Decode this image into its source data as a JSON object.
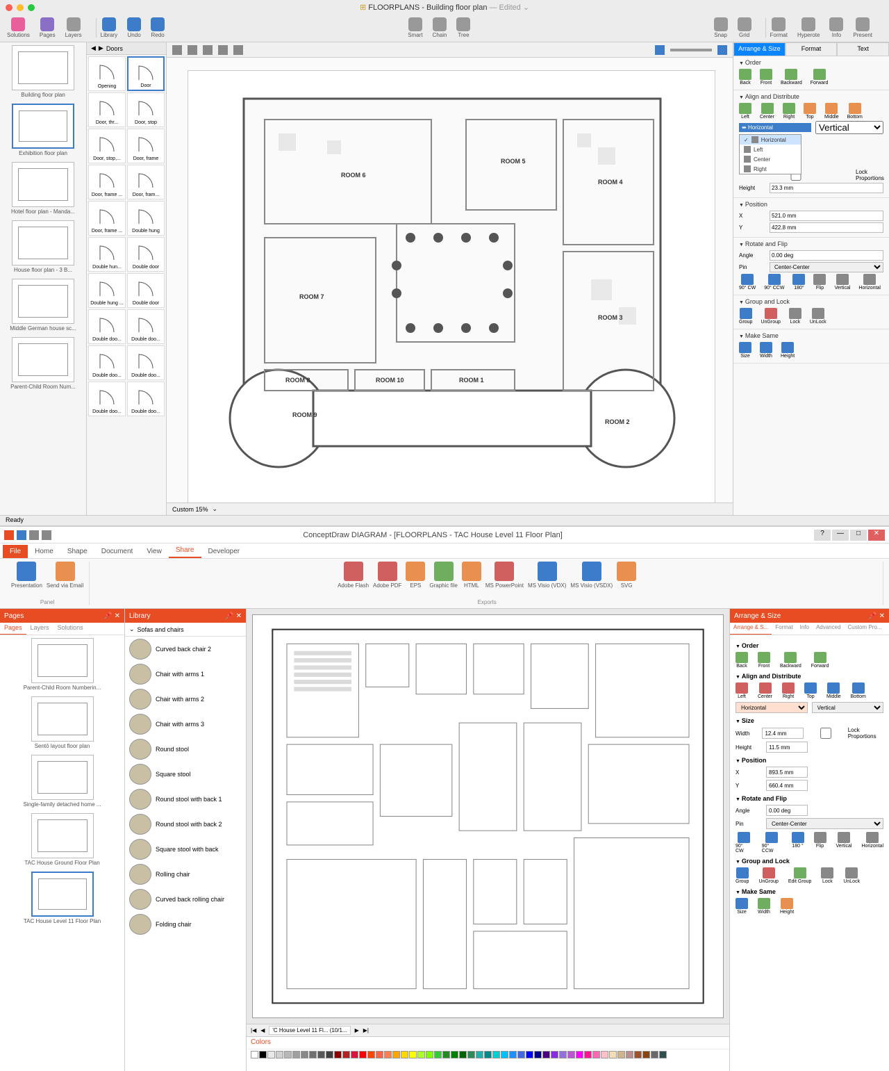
{
  "app1": {
    "title_prefix": "FLOORPLANS",
    "title_doc": "Building floor plan",
    "title_suffix": "— Edited",
    "toolbar_left": [
      "Solutions",
      "Pages",
      "Layers"
    ],
    "toolbar_mid": [
      "Library",
      "Undo",
      "Redo"
    ],
    "toolbar_center": [
      "Smart",
      "Chain",
      "Tree"
    ],
    "toolbar_right": [
      "Snap",
      "Grid"
    ],
    "toolbar_far": [
      "Format",
      "Hyperote",
      "Info",
      "Present"
    ],
    "thumbs": [
      {
        "label": "Building floor plan",
        "sel": false
      },
      {
        "label": "Exhibition floor plan",
        "sel": true
      },
      {
        "label": "Hotel floor plan - Manda...",
        "sel": false
      },
      {
        "label": "House floor plan - 3 B...",
        "sel": false
      },
      {
        "label": "Middle German house sc...",
        "sel": false
      },
      {
        "label": "Parent-Child Room Num...",
        "sel": false
      }
    ],
    "lib_name": "Doors",
    "lib_items": [
      "Opening",
      "Door",
      "Door, thr...",
      "Door, stop",
      "Door, stop,...",
      "Door, frame",
      "Door, frame ...",
      "Door, fram...",
      "Door, frame ...",
      "Double hung",
      "Double hun...",
      "Double door",
      "Double hung ...",
      "Double door",
      "Double doo...",
      "Double doo...",
      "Double doo...",
      "Double doo...",
      "Double doo...",
      "Double doo..."
    ],
    "rooms": [
      "ROOM 1",
      "ROOM 2",
      "ROOM 3",
      "ROOM 4",
      "ROOM 5",
      "ROOM 6",
      "ROOM 7",
      "ROOM 8",
      "ROOM 9",
      "ROOM 10"
    ],
    "zoom_label": "Custom 15%",
    "prop_tabs": [
      "Arrange & Size",
      "Format",
      "Text"
    ],
    "order_h": "Order",
    "order_btns": [
      "Back",
      "Front",
      "Backward",
      "Forward"
    ],
    "align_h": "Align and Distribute",
    "align_btns": [
      "Left",
      "Center",
      "Right",
      "Top",
      "Middle",
      "Bottom"
    ],
    "align_dd_sel": "Horizontal",
    "align_dd_items": [
      "Horizontal",
      "Left",
      "Center",
      "Right"
    ],
    "align_dd2": "Vertical",
    "lock_prop": "Lock Proportions",
    "size_height_lbl": "Height",
    "size_height": "23.3 mm",
    "position_h": "Position",
    "pos_x_lbl": "X",
    "pos_x": "521.0 mm",
    "pos_y_lbl": "Y",
    "pos_y": "422.8 mm",
    "rotate_h": "Rotate and Flip",
    "angle_lbl": "Angle",
    "angle": "0.00 deg",
    "pin_lbl": "Pin",
    "pin": "Center-Center",
    "rotate_btns": [
      "90° CW",
      "90° CCW",
      "180°",
      "Flip",
      "Vertical",
      "Horizontal"
    ],
    "group_h": "Group and Lock",
    "group_btns": [
      "Group",
      "UnGroup",
      "Lock",
      "UnLock"
    ],
    "make_h": "Make Same",
    "make_btns": [
      "Size",
      "Width",
      "Height"
    ],
    "status": "Ready"
  },
  "app2": {
    "title": "ConceptDraw DIAGRAM - [FLOORPLANS - TAC House Level 11 Floor Plan]",
    "ribbon_tabs": [
      "File",
      "Home",
      "Shape",
      "Document",
      "View",
      "Share",
      "Developer"
    ],
    "ribbon_active": "Share",
    "panel_btns": [
      "Presentation",
      "Send via Email"
    ],
    "panel_lbl": "Panel",
    "export_btns": [
      "Adobe Flash",
      "Adobe PDF",
      "EPS",
      "Graphic file",
      "HTML",
      "MS PowerPoint",
      "MS Visio (VDX)",
      "MS Visio (VSDX)",
      "SVG"
    ],
    "export_lbl": "Exports",
    "pages_title": "Pages",
    "pages_tabs": [
      "Pages",
      "Layers",
      "Solutions"
    ],
    "pages": [
      {
        "label": "Parent-Child Room Numberin...",
        "sel": false
      },
      {
        "label": "Sentō layout floor plan",
        "sel": false
      },
      {
        "label": "Single-family detached home ...",
        "sel": false
      },
      {
        "label": "TAC House Ground Floor Plan",
        "sel": false
      },
      {
        "label": "TAC House Level 11 Floor Plan",
        "sel": true
      }
    ],
    "lib_title": "Library",
    "lib_category": "Sofas and chairs",
    "lib_items": [
      "Curved back chair 2",
      "Chair with arms 1",
      "Chair with arms 2",
      "Chair with arms 3",
      "Round stool",
      "Square stool",
      "Round stool with back 1",
      "Round stool with back 2",
      "Square stool with back",
      "Rolling chair",
      "Curved back rolling chair",
      "Folding chair"
    ],
    "sheet_tab": "'C House Level 11 Fl...  (10/1...",
    "colors_title": "Colors",
    "props_title": "Arrange & Size",
    "prop_tabs": [
      "Arrange & S...",
      "Format",
      "Info",
      "Advanced",
      "Custom Pro..."
    ],
    "order_h": "Order",
    "order_btns": [
      "Back",
      "Front",
      "Backward",
      "Forward"
    ],
    "align_h": "Align and Distribute",
    "align_btns": [
      "Left",
      "Center",
      "Right",
      "Top",
      "Middle",
      "Bottom"
    ],
    "align_sel1": "Horizontal",
    "align_sel2": "Vertical",
    "size_h": "Size",
    "width_lbl": "Width",
    "width": "12.4 mm",
    "height_lbl": "Height",
    "height": "11.5 mm",
    "lock_prop": "Lock Proportions",
    "position_h": "Position",
    "pos_x_lbl": "X",
    "pos_x": "893.5 mm",
    "pos_y_lbl": "Y",
    "pos_y": "660.4 mm",
    "rotate_h": "Rotate and Flip",
    "angle_lbl": "Angle",
    "angle": "0.00 deg",
    "pin_lbl": "Pin",
    "pin": "Center-Center",
    "rotate_btns": [
      "90° CW",
      "90° CCW",
      "180 °",
      "Flip",
      "Vertical",
      "Horizontal"
    ],
    "group_h": "Group and Lock",
    "group_btns": [
      "Group",
      "UnGroup",
      "Edit Group",
      "Lock",
      "UnLock"
    ],
    "make_h": "Make Same",
    "make_btns": [
      "Size",
      "Width",
      "Height"
    ],
    "swatch_colors": [
      "#fff",
      "#000",
      "#e8e8e8",
      "#d0d0d0",
      "#b8b8b8",
      "#a0a0a0",
      "#888",
      "#707070",
      "#585858",
      "#404040",
      "#8b0000",
      "#b22222",
      "#dc143c",
      "#ff0000",
      "#ff4500",
      "#ff6347",
      "#ff7f50",
      "#ffa500",
      "#ffd700",
      "#ffff00",
      "#adff2f",
      "#7fff00",
      "#32cd32",
      "#228b22",
      "#008000",
      "#006400",
      "#2e8b57",
      "#20b2aa",
      "#008b8b",
      "#00ced1",
      "#00bfff",
      "#1e90ff",
      "#4169e1",
      "#0000ff",
      "#00008b",
      "#4b0082",
      "#8a2be2",
      "#9370db",
      "#ba55d3",
      "#ff00ff",
      "#ff1493",
      "#ff69b4",
      "#ffc0cb",
      "#f5deb3",
      "#d2b48c",
      "#bc8f8f",
      "#a0522d",
      "#8b4513",
      "#696969",
      "#2f4f4f"
    ]
  }
}
